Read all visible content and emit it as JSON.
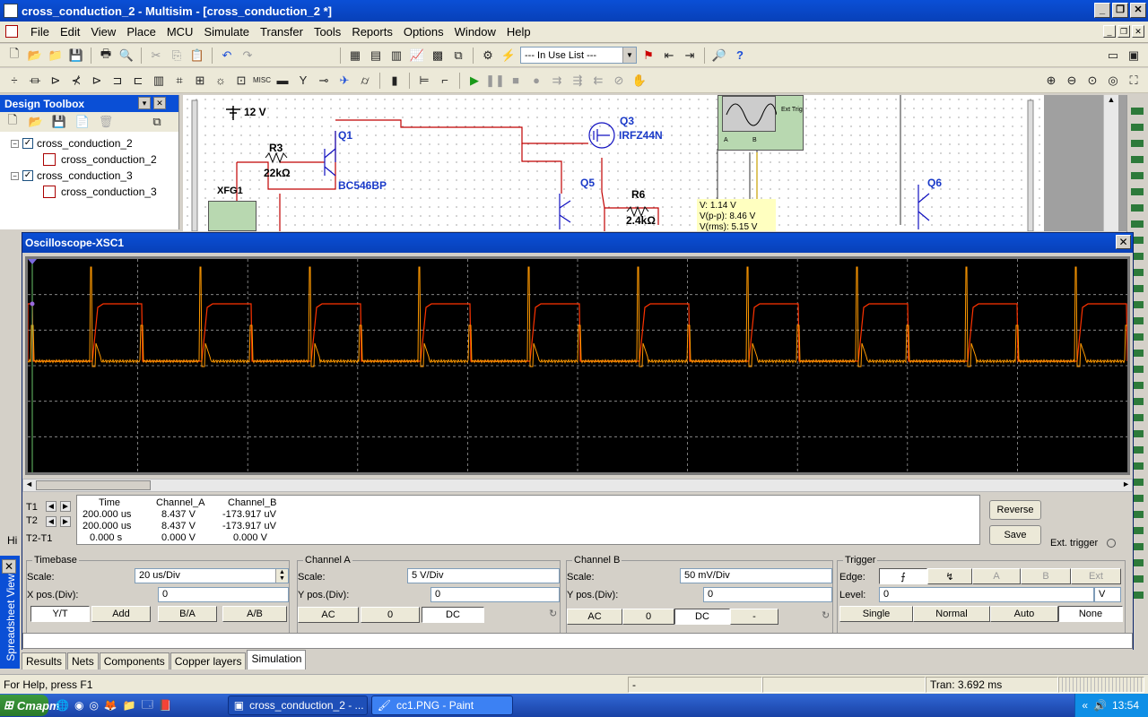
{
  "window": {
    "title": "cross_conduction_2 - Multisim - [cross_conduction_2 *]"
  },
  "menu": [
    "File",
    "Edit",
    "View",
    "Place",
    "MCU",
    "Simulate",
    "Transfer",
    "Tools",
    "Reports",
    "Options",
    "Window",
    "Help"
  ],
  "toolbar": {
    "in_use_list": "--- In Use List ---"
  },
  "toolbox": {
    "title": "Design Toolbox",
    "tree": [
      {
        "label": "cross_conduction_2",
        "child": "cross_conduction_2"
      },
      {
        "label": "cross_conduction_3",
        "child": "cross_conduction_3"
      }
    ]
  },
  "schematic": {
    "v1_value": "12 V",
    "r3_name": "R3",
    "r3_value": "22kΩ",
    "q1_name": "Q1",
    "q1_part": "BC546BP",
    "xfg_name": "XFG1",
    "q3_name": "Q3",
    "q3_part": "IRFZ44N",
    "q5_name": "Q5",
    "r6_name": "R6",
    "r6_value": "2.4kΩ",
    "q6_name": "Q6",
    "ext_trig": "Ext Trig",
    "probe_a": "A",
    "probe_b": "B",
    "probe_v": "V: 1.14 V",
    "probe_vpp": "V(p-p): 8.46 V",
    "probe_vrms": "V(rms): 5.15 V"
  },
  "scope": {
    "title": "Oscilloscope-XSC1",
    "cursor_table": {
      "headers": [
        "Time",
        "Channel_A",
        "Channel_B"
      ],
      "rows": [
        {
          "label": "T1",
          "time": "200.000 us",
          "a": "8.437 V",
          "b": "-173.917 uV"
        },
        {
          "label": "T2",
          "time": "200.000 us",
          "a": "8.437 V",
          "b": "-173.917 uV"
        },
        {
          "label": "T2-T1",
          "time": "0.000 s",
          "a": "0.000 V",
          "b": "0.000 V"
        }
      ]
    },
    "reverse_label": "Reverse",
    "save_label": "Save",
    "ext_trigger_label": "Ext. trigger",
    "timebase": {
      "title": "Timebase",
      "scale_label": "Scale:",
      "scale": "20 us/Div",
      "xpos_label": "X pos.(Div):",
      "xpos": "0",
      "buttons": [
        "Y/T",
        "Add",
        "B/A",
        "A/B"
      ]
    },
    "channel_a": {
      "title": "Channel A",
      "scale_label": "Scale:",
      "scale": "5  V/Div",
      "ypos_label": "Y pos.(Div):",
      "ypos": "0",
      "buttons": [
        "AC",
        "0",
        "DC"
      ]
    },
    "channel_b": {
      "title": "Channel B",
      "scale_label": "Scale:",
      "scale": "50 mV/Div",
      "ypos_label": "Y pos.(Div):",
      "ypos": "0",
      "buttons": [
        "AC",
        "0",
        "DC",
        "-"
      ]
    },
    "trigger": {
      "title": "Trigger",
      "edge_label": "Edge:",
      "source_buttons": [
        "A",
        "B",
        "Ext"
      ],
      "level_label": "Level:",
      "level": "0",
      "level_unit": "V",
      "modes": [
        "Single",
        "Normal",
        "Auto",
        "None"
      ]
    }
  },
  "tabs": [
    "Results",
    "Nets",
    "Components",
    "Copper layers",
    "Simulation"
  ],
  "status": {
    "help": "For Help, press F1",
    "mid": "-",
    "tran": "Tran: 3.692 ms"
  },
  "side_label": "Spreadsheet View",
  "hi_label": "Hi",
  "taskbar": {
    "start": "Старт",
    "tasks": [
      "cross_conduction_2 - ...",
      "cc1.PNG - Paint"
    ],
    "time": "13:54"
  },
  "colors": {
    "title_bar": "#0a4fd6",
    "trace_a": "#ff3300",
    "trace_b": "#ff9900",
    "scope_bg": "#000000"
  }
}
